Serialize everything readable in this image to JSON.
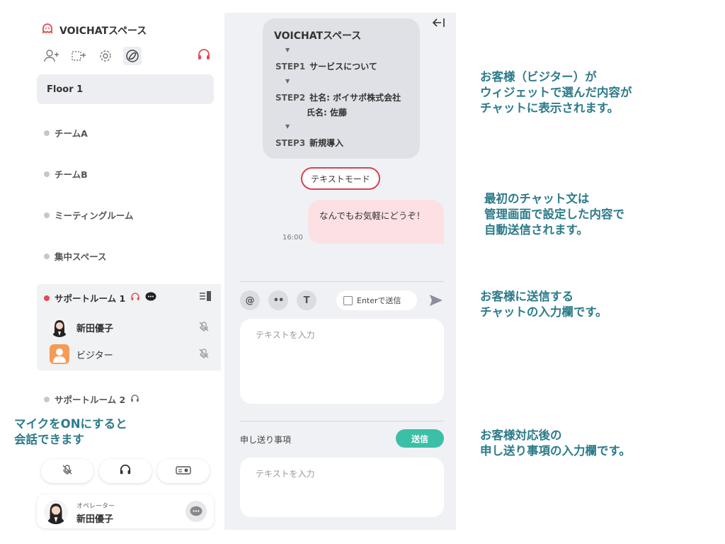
{
  "sidebar": {
    "brand": "VOICHATスペース",
    "floor": "Floor 1",
    "rooms": [
      "チームA",
      "チームB",
      "ミーティングルーム",
      "集中スペース"
    ],
    "support_room_1": "サポートルーム 1",
    "support_room_2": "サポートルーム 2",
    "members": [
      {
        "name": "新田優子"
      },
      {
        "name": "ビジター"
      }
    ],
    "operator": {
      "role": "オペレーター",
      "name": "新田優子"
    }
  },
  "chat": {
    "flow": {
      "title": "VOICHATスペース",
      "steps": [
        {
          "label": "STEP1",
          "text": "サービスについて"
        },
        {
          "label": "STEP2",
          "text": "社名: ボイサポ株式会社",
          "text2": "氏名: 佐藤"
        },
        {
          "label": "STEP3",
          "text": "新規導入"
        }
      ]
    },
    "mode": "テキストモード",
    "message": {
      "text": "なんでもお気軽にどうぞ！",
      "time": "16:00"
    },
    "toolbar": {
      "mention": "@",
      "emoji": "••",
      "text_format": "T",
      "enter_send": "Enterで送信"
    },
    "input_placeholder": "テキストを入力",
    "handover": {
      "label": "申し送り事項",
      "send": "送信",
      "placeholder": "テキストを入力"
    }
  },
  "notes": [
    "お客様（ビジター）が\nウィジェットで選んだ内容が\nチャットに表示されます。",
    "最初のチャット文は\n管理画面で設定した内容で\n自動送信されます。",
    "お客様に送信する\nチャットの入力欄です。",
    "お客様対応後の\n申し送り事項の入力欄です。",
    "マイクをONにすると\n会話できます"
  ],
  "colors": {
    "accent_red": "#e54b55",
    "teal": "#3bbfa7",
    "note": "#2d7b8a"
  }
}
